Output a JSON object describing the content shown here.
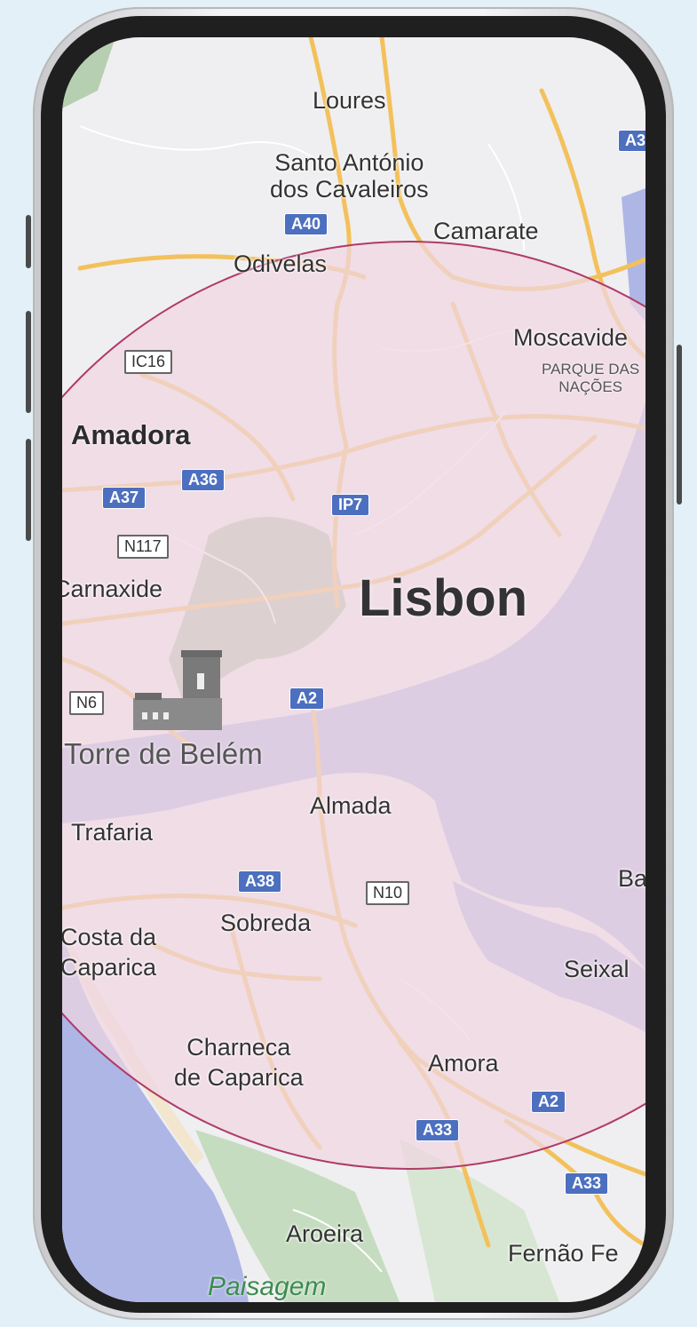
{
  "map": {
    "city": "Lisbon",
    "places": {
      "loures": "Loures",
      "santo_antonio": "Santo António\ndos Cavaleiros",
      "camarate": "Camarate",
      "odivelas": "Odivelas",
      "moscavide": "Moscavide",
      "parque_nacoes": "PARQUE DAS\nNAÇÕES",
      "amadora": "Amadora",
      "carnaxide": "Carnaxide",
      "torre_belem": "Torre de Belém",
      "almada": "Almada",
      "trafaria": "Trafaria",
      "sobreda": "Sobreda",
      "costa_caparica": "Costa da\nCaparica",
      "barreiro": "Ba",
      "seixal": "Seixal",
      "charneca": "Charneca\nde Caparica",
      "amora": "Amora",
      "aroeira": "Aroeira",
      "fernao": "Fernão Fe",
      "paisagem": "Paisagem"
    },
    "roads": {
      "a40": "A40",
      "a36": "A36",
      "a37": "A37",
      "ip7": "IP7",
      "a2": "A2",
      "a38": "A38",
      "a33": "A33",
      "a3": "A3",
      "ic16": "IC16",
      "n117": "N117",
      "n6": "N6",
      "n10": "N10"
    },
    "colors": {
      "water": "#aeb6e6",
      "land": "#efeff1",
      "radius_fill": "#f0d6e2",
      "radius_stroke": "#b03a68",
      "road": "#f3c15c",
      "park": "#a9c7a2"
    }
  }
}
